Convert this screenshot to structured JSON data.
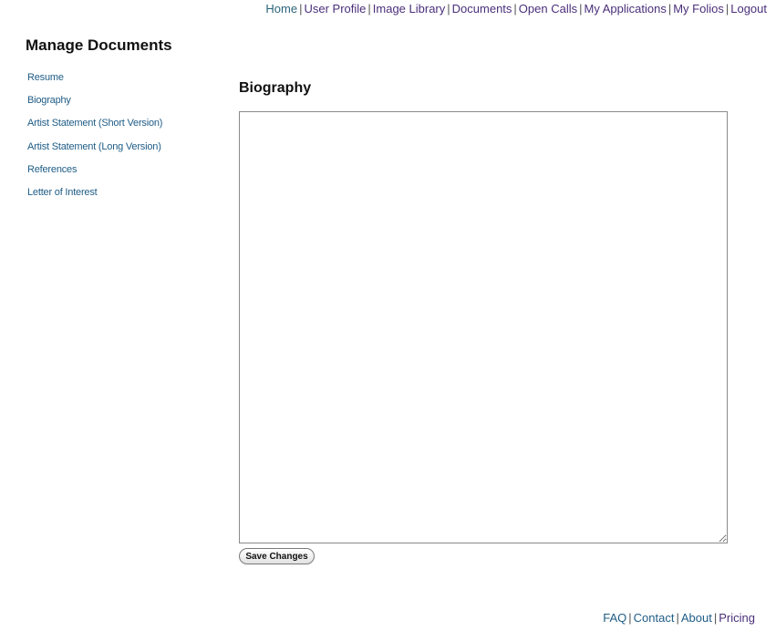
{
  "top_nav": {
    "items": [
      {
        "label": "Home"
      },
      {
        "label": "User Profile"
      },
      {
        "label": "Image Library"
      },
      {
        "label": "Documents"
      },
      {
        "label": "Open Calls"
      },
      {
        "label": "My Applications"
      },
      {
        "label": "My Folios"
      },
      {
        "label": "Logout"
      }
    ],
    "separator": "|"
  },
  "sidebar": {
    "title": "Manage Documents",
    "items": [
      {
        "label": "Resume"
      },
      {
        "label": "Biography"
      },
      {
        "label": "Artist Statement (Short Version)"
      },
      {
        "label": "Artist Statement (Long Version)"
      },
      {
        "label": "References"
      },
      {
        "label": "Letter of Interest"
      }
    ]
  },
  "main": {
    "title": "Biography",
    "textarea_value": "",
    "save_label": "Save Changes"
  },
  "footer": {
    "items": [
      {
        "label": "FAQ"
      },
      {
        "label": "Contact"
      },
      {
        "label": "About"
      },
      {
        "label": "Pricing"
      }
    ],
    "separator": "|"
  },
  "colors": {
    "link_unvisited": "#1f5c86",
    "link_visited": "#4a2f7a",
    "heading": "#111111"
  }
}
